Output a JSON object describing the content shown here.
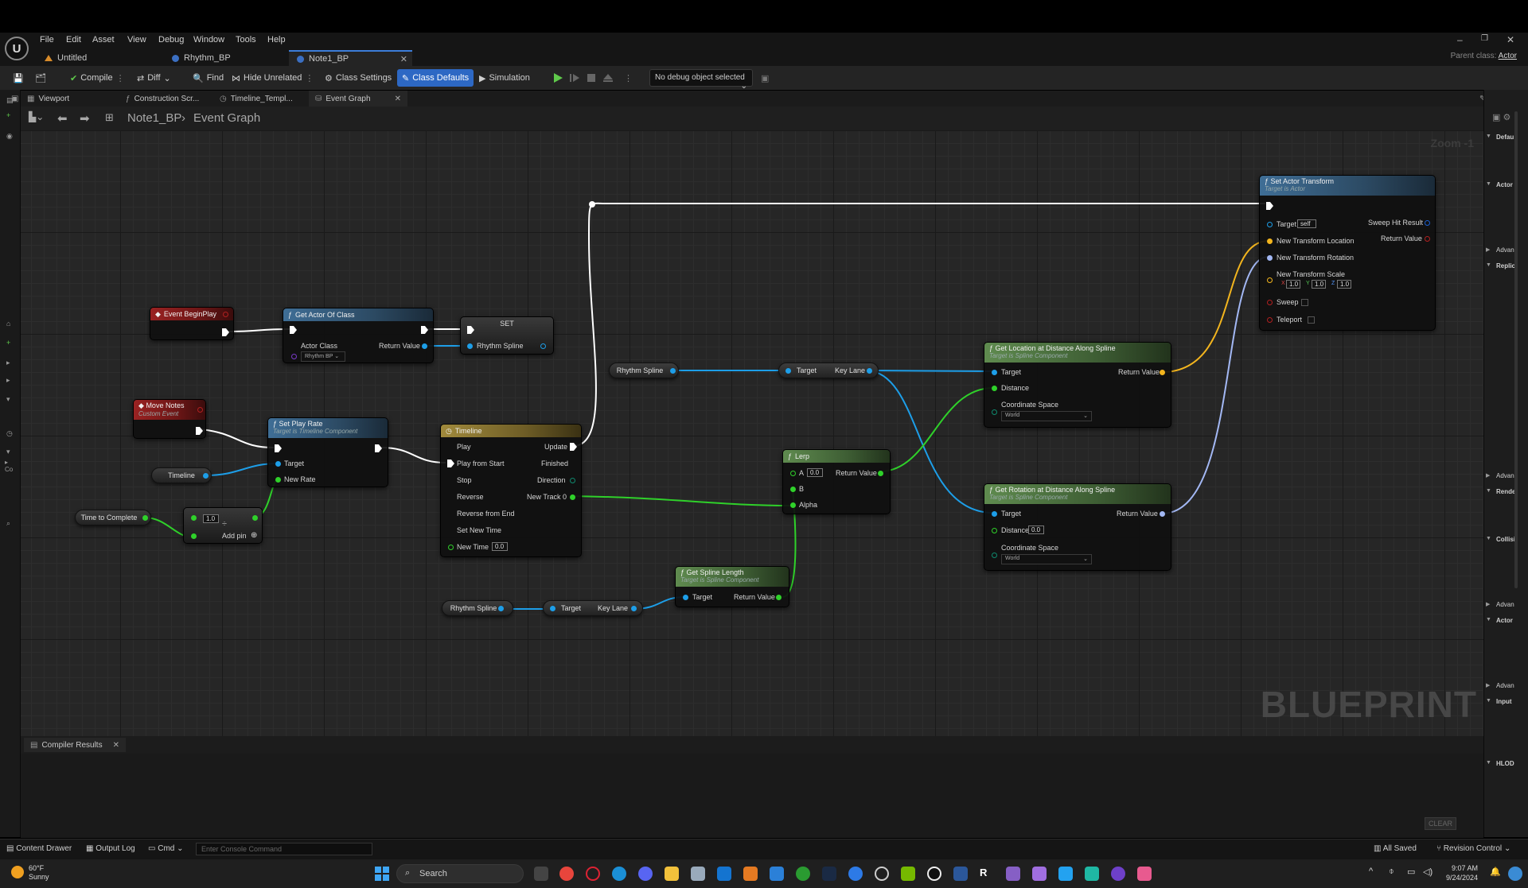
{
  "menu": [
    "File",
    "Edit",
    "Asset",
    "View",
    "Debug",
    "Window",
    "Tools",
    "Help"
  ],
  "doc_tabs": [
    "Untitled",
    "Rhythm_BP",
    "Note1_BP"
  ],
  "parent_class": {
    "label": "Parent class:",
    "value": "Actor"
  },
  "toolbar": {
    "compile": "Compile",
    "diff": "Diff",
    "find": "Find",
    "hide_unrelated": "Hide Unrelated",
    "class_settings": "Class Settings",
    "class_defaults": "Class Defaults",
    "simulation": "Simulation",
    "debug_select": "No debug object selected"
  },
  "graph_tabs": [
    "Viewport",
    "Construction Scr...",
    "Timeline_Templ...",
    "Event Graph"
  ],
  "breadcrumb": {
    "blueprint": "Note1_BP",
    "graph": "Event Graph"
  },
  "zoom": "Zoom -1",
  "watermark": "BLUEPRINT",
  "nodes": {
    "begin_play": {
      "title": "Event BeginPlay"
    },
    "get_actor_of_class": {
      "title": "Get Actor Of Class",
      "actor_class": "Actor Class",
      "actor_class_value": "Rhythm BP",
      "return": "Return Value"
    },
    "set": {
      "title": "SET",
      "pin": "Rhythm Spline"
    },
    "move_notes": {
      "title": "Move Notes",
      "subtitle": "Custom Event"
    },
    "set_play_rate": {
      "title": "Set Play Rate",
      "subtitle": "Target is Timeline Component",
      "target": "Target",
      "new_rate": "New Rate"
    },
    "timeline_var": "Timeline",
    "time_to_complete": "Time to Complete",
    "divide": {
      "value": "1.0",
      "add_pin": "Add pin"
    },
    "timeline": {
      "title": "Timeline",
      "play": "Play",
      "play_from_start": "Play from Start",
      "stop": "Stop",
      "reverse": "Reverse",
      "reverse_from_end": "Reverse from End",
      "set_new_time": "Set New Time",
      "new_time": "New Time",
      "new_time_value": "0.0",
      "update": "Update",
      "finished": "Finished",
      "direction": "Direction",
      "new_track": "New Track 0"
    },
    "rhythm_spline_1": "Rhythm Spline",
    "key_lane_1": {
      "target": "Target",
      "key_lane": "Key Lane"
    },
    "lerp": {
      "title": "Lerp",
      "a": "A",
      "a_value": "0.0",
      "b": "B",
      "alpha": "Alpha",
      "return": "Return Value"
    },
    "get_location": {
      "title": "Get Location at Distance Along Spline",
      "subtitle": "Target is Spline Component",
      "target": "Target",
      "distance": "Distance",
      "coord_space": "Coordinate Space",
      "coord_value": "World",
      "return": "Return Value"
    },
    "get_rotation": {
      "title": "Get Rotation at Distance Along Spline",
      "subtitle": "Target is Spline Component",
      "target": "Target",
      "distance": "Distance",
      "distance_value": "0.0",
      "coord_space": "Coordinate Space",
      "coord_value": "World",
      "return": "Return Value"
    },
    "set_actor_transform": {
      "title": "Set Actor Transform",
      "subtitle": "Target is Actor",
      "target": "Target",
      "target_value": "self",
      "location": "New Transform Location",
      "rotation": "New Transform Rotation",
      "scale": "New Transform Scale",
      "scale_x": "1.0",
      "scale_y": "1.0",
      "scale_z": "1.0",
      "sweep": "Sweep",
      "teleport": "Teleport",
      "sweep_hit": "Sweep Hit Result",
      "return": "Return Value"
    },
    "rhythm_spline_2": "Rhythm Spline",
    "key_lane_2": {
      "target": "Target",
      "key_lane": "Key Lane"
    },
    "spline_length": {
      "title": "Get Spline Length",
      "subtitle": "Target is Spline Component",
      "target": "Target",
      "return": "Return Value"
    }
  },
  "right_panel": [
    "Defau",
    "Actor",
    "Advan",
    "Replic",
    "Advan",
    "Rende",
    "Collisi",
    "Advan",
    "Actor",
    "Advan",
    "Input",
    "HLOD"
  ],
  "bottom": {
    "compiler_tab": "Compiler Results",
    "clear": "CLEAR"
  },
  "status": {
    "content_drawer": "Content Drawer",
    "output_log": "Output Log",
    "cmd": "Cmd",
    "console_placeholder": "Enter Console Command",
    "all_saved": "All Saved",
    "revision": "Revision Control"
  },
  "taskbar": {
    "temp": "60°F",
    "weather": "Sunny",
    "search": "Search",
    "time": "9:07 AM",
    "date": "9/24/2024"
  }
}
